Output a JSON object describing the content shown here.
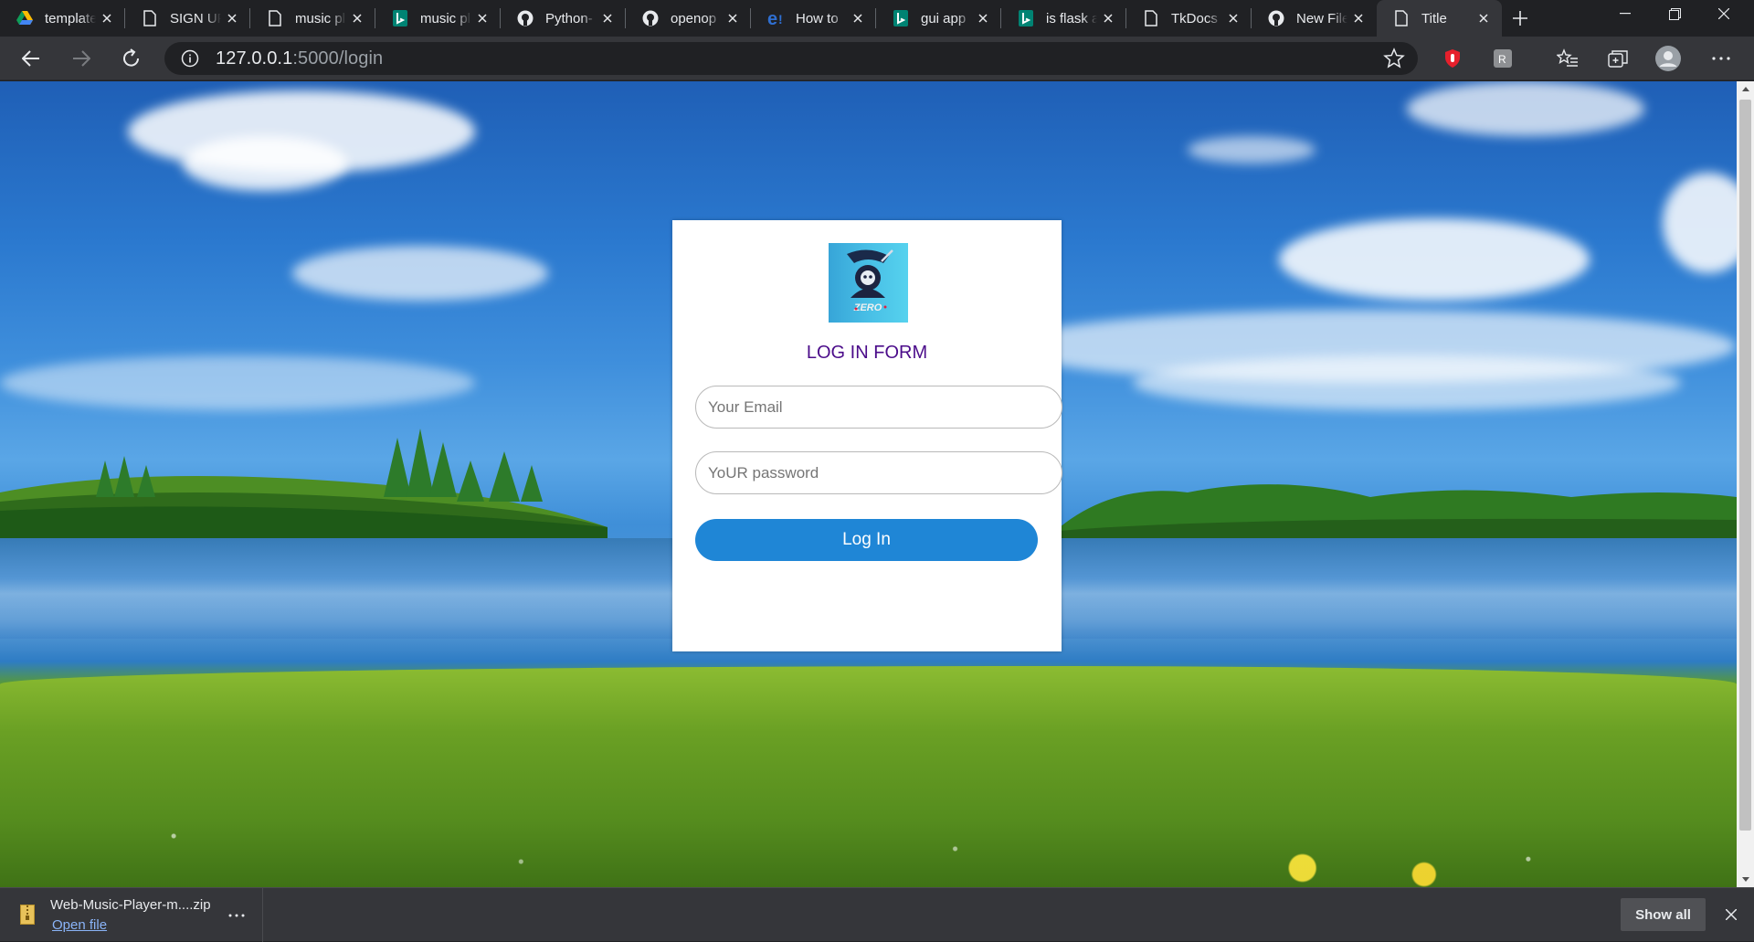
{
  "browser": {
    "tabs": [
      {
        "title": "template",
        "icon": "google-drive-icon"
      },
      {
        "title": "SIGN UP",
        "icon": "page-icon"
      },
      {
        "title": "music player",
        "icon": "page-icon"
      },
      {
        "title": "music player",
        "icon": "bing-icon"
      },
      {
        "title": "Python-",
        "icon": "github-icon"
      },
      {
        "title": "openop",
        "icon": "github-icon"
      },
      {
        "title": "How to",
        "icon": "edge-icon"
      },
      {
        "title": "gui app",
        "icon": "bing-icon"
      },
      {
        "title": "is flask a",
        "icon": "bing-icon"
      },
      {
        "title": "TkDocs",
        "icon": "page-icon"
      },
      {
        "title": "New File",
        "icon": "github-icon"
      },
      {
        "title": "Title",
        "icon": "page-icon",
        "active": true
      }
    ],
    "address": {
      "host": "127.0.0.1",
      "path": ":5000/login"
    }
  },
  "login": {
    "title": "LOG IN FORM",
    "email_placeholder": "Your Email",
    "password_placeholder": "YoUR password",
    "button_label": "Log In",
    "logo_text": "ZERO"
  },
  "downloads": {
    "file_name": "Web-Music-Player-m....zip",
    "open_label": "Open file",
    "show_all_label": "Show all"
  },
  "colors": {
    "title": "#4b0c8a",
    "button": "#1f86d6",
    "chrome_dark": "#202124",
    "chrome_mid": "#35363a"
  }
}
